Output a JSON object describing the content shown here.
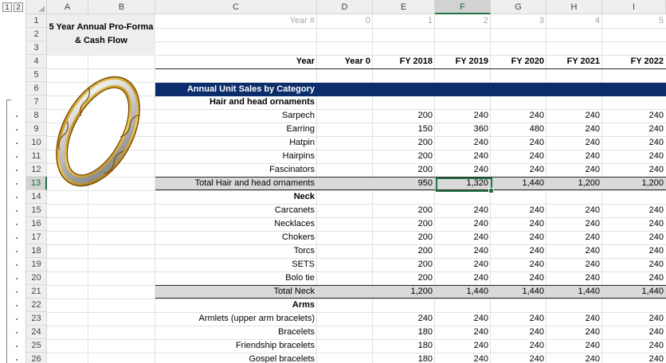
{
  "outline": {
    "levels": [
      "1",
      "2"
    ]
  },
  "columns": [
    "A",
    "B",
    "C",
    "D",
    "E",
    "F",
    "G",
    "H",
    "I"
  ],
  "selected_column": "F",
  "rows": [
    "1",
    "2",
    "3",
    "4",
    "5",
    "6",
    "7",
    "8",
    "9",
    "10",
    "11",
    "12",
    "13",
    "14",
    "15",
    "16",
    "17",
    "18",
    "19",
    "20",
    "21",
    "22",
    "23",
    "24",
    "25",
    "26"
  ],
  "selected_row": "13",
  "title": {
    "line1": "5 Year Annual Pro-Forma",
    "line2": "& Cash Flow"
  },
  "year_index": {
    "label": "Year #",
    "values": [
      "0",
      "1",
      "2",
      "3",
      "4",
      "5"
    ]
  },
  "year_header": {
    "label": "Year",
    "values": [
      "Year 0",
      "FY 2018",
      "FY 2019",
      "FY 2020",
      "FY 2021",
      "FY 2022"
    ]
  },
  "section_banner": "Annual Unit Sales by Category",
  "image": {
    "icon": "gold-ring-image"
  },
  "colors": {
    "banner": "#0b2d6b",
    "total_fill": "#d9d9d9",
    "selection": "#217346"
  },
  "sheet_rows": [
    {
      "row": "7",
      "type": "category",
      "label": "Hair and head ornaments",
      "values": []
    },
    {
      "row": "8",
      "type": "item",
      "label": "Sarpech",
      "values": [
        "200",
        "240",
        "240",
        "240",
        "240"
      ]
    },
    {
      "row": "9",
      "type": "item",
      "label": "Earring",
      "values": [
        "150",
        "360",
        "480",
        "240",
        "240"
      ]
    },
    {
      "row": "10",
      "type": "item",
      "label": "Hatpin",
      "values": [
        "200",
        "240",
        "240",
        "240",
        "240"
      ]
    },
    {
      "row": "11",
      "type": "item",
      "label": "Hairpins",
      "values": [
        "200",
        "240",
        "240",
        "240",
        "240"
      ]
    },
    {
      "row": "12",
      "type": "item",
      "label": "Fascinators",
      "values": [
        "200",
        "240",
        "240",
        "240",
        "240"
      ]
    },
    {
      "row": "13",
      "type": "total",
      "label": "Total Hair and head ornaments",
      "values": [
        "950",
        "1,320",
        "1,440",
        "1,200",
        "1,200"
      ]
    },
    {
      "row": "14",
      "type": "category",
      "label": "Neck",
      "values": []
    },
    {
      "row": "15",
      "type": "item",
      "label": "Carcanets",
      "values": [
        "200",
        "240",
        "240",
        "240",
        "240"
      ]
    },
    {
      "row": "16",
      "type": "item",
      "label": "Necklaces",
      "values": [
        "200",
        "240",
        "240",
        "240",
        "240"
      ]
    },
    {
      "row": "17",
      "type": "item",
      "label": "Chokers",
      "values": [
        "200",
        "240",
        "240",
        "240",
        "240"
      ]
    },
    {
      "row": "18",
      "type": "item",
      "label": "Torcs",
      "values": [
        "200",
        "240",
        "240",
        "240",
        "240"
      ]
    },
    {
      "row": "19",
      "type": "item",
      "label": "SETS",
      "values": [
        "200",
        "240",
        "240",
        "240",
        "240"
      ]
    },
    {
      "row": "20",
      "type": "item",
      "label": "Bolo tie",
      "values": [
        "200",
        "240",
        "240",
        "240",
        "240"
      ]
    },
    {
      "row": "21",
      "type": "total",
      "label": "Total Neck",
      "values": [
        "1,200",
        "1,440",
        "1,440",
        "1,440",
        "1,440"
      ]
    },
    {
      "row": "22",
      "type": "category",
      "label": "Arms",
      "values": []
    },
    {
      "row": "23",
      "type": "item",
      "label": "Armlets (upper arm bracelets)",
      "values": [
        "240",
        "240",
        "240",
        "240",
        "240"
      ]
    },
    {
      "row": "24",
      "type": "item",
      "label": "Bracelets",
      "values": [
        "180",
        "240",
        "240",
        "240",
        "240"
      ]
    },
    {
      "row": "25",
      "type": "item",
      "label": "Friendship bracelets",
      "values": [
        "180",
        "240",
        "240",
        "240",
        "240"
      ]
    },
    {
      "row": "26",
      "type": "item",
      "label": "Gospel bracelets",
      "values": [
        "180",
        "240",
        "240",
        "240",
        "240"
      ]
    }
  ]
}
